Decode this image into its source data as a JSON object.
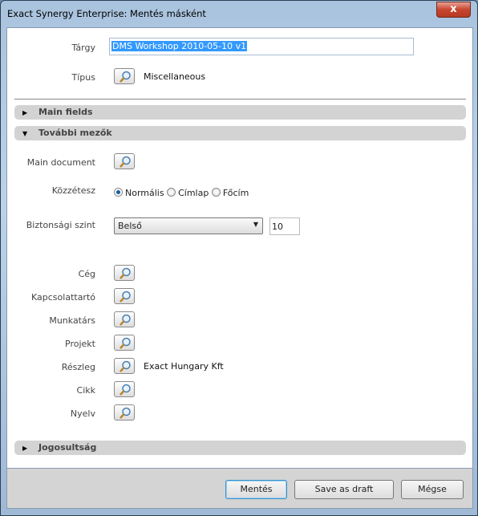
{
  "window": {
    "title": "Exact Synergy Enterprise: Mentés másként",
    "close": "x"
  },
  "fields": {
    "subject": {
      "label": "Tárgy",
      "value": "DMS Workshop 2010-05-10 v1"
    },
    "type": {
      "label": "Típus",
      "value": "Miscellaneous"
    },
    "main_document": {
      "label": "Main document"
    },
    "publish": {
      "label": "Közzétesz",
      "options": [
        "Normális",
        "Címlap",
        "Főcím"
      ],
      "selected": "Normális"
    },
    "security": {
      "label": "Biztonsági szint",
      "value": "Belső",
      "level": "10"
    },
    "lookups": [
      {
        "label": "Cég",
        "value": ""
      },
      {
        "label": "Kapcsolattartó",
        "value": ""
      },
      {
        "label": "Munkatárs",
        "value": ""
      },
      {
        "label": "Projekt",
        "value": ""
      },
      {
        "label": "Részleg",
        "value": "Exact Hungary Kft"
      },
      {
        "label": "Cikk",
        "value": ""
      },
      {
        "label": "Nyelv",
        "value": ""
      }
    ]
  },
  "sections": {
    "main_fields": "Main fields",
    "additional": "További mezők",
    "rights": "Jogosultság"
  },
  "buttons": {
    "save": "Mentés",
    "draft": "Save as draft",
    "cancel": "Mégse"
  },
  "icons": {
    "lookup": "magnifier-icon",
    "collapsed": "triangle-right-icon",
    "expanded": "triangle-down-icon"
  }
}
